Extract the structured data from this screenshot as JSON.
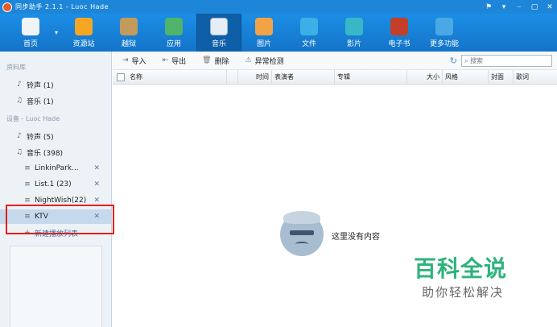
{
  "window": {
    "title": "同步助手 2.1.1 - Luoc Hade",
    "controls": [
      "⚑",
      "▾",
      "⎯",
      "▢",
      "✕"
    ]
  },
  "toolbar": {
    "items": [
      {
        "label": "首页"
      },
      {
        "label": "资源站"
      },
      {
        "label": "越狱"
      },
      {
        "label": "应用"
      },
      {
        "label": "音乐"
      },
      {
        "label": "图片"
      },
      {
        "label": "文件"
      },
      {
        "label": "影片"
      },
      {
        "label": "电子书"
      },
      {
        "label": "更多功能"
      }
    ],
    "active": "音乐"
  },
  "sidebar": {
    "library_section": "资料库",
    "library_items": [
      {
        "label": "铃声 (1)",
        "icon": "bell-icon"
      },
      {
        "label": "音乐 (1)",
        "icon": "music-note-icon"
      }
    ],
    "device_section": "设备 - Luoc Hade",
    "device_items": [
      {
        "label": "铃声 (5)",
        "icon": "bell-icon"
      },
      {
        "label": "音乐 (398)",
        "icon": "music-note-icon"
      }
    ],
    "playlists": [
      {
        "label": "LinkinPark..."
      },
      {
        "label": "List.1 (23)"
      },
      {
        "label": "NightWish(22)"
      },
      {
        "label": "KTV"
      }
    ],
    "selected_playlist": "KTV",
    "new_playlist_label": "新建播放列表"
  },
  "actions": {
    "import_label": "导入",
    "export_label": "导出",
    "delete_label": "删除",
    "check_label": "异常检测",
    "search_placeholder": "搜索"
  },
  "table": {
    "columns": [
      "名称",
      "时间",
      "表演者",
      "专辑",
      "大小",
      "风格",
      "封面",
      "歌词"
    ]
  },
  "empty_state": {
    "message": "这里没有内容"
  },
  "watermark": {
    "title": "百科全说",
    "subtitle": "助你轻松解决"
  },
  "colors": {
    "toolbar_blue": "#1b8ee6",
    "highlight_red": "#e0201d",
    "watermark_green": "#2db37a"
  }
}
